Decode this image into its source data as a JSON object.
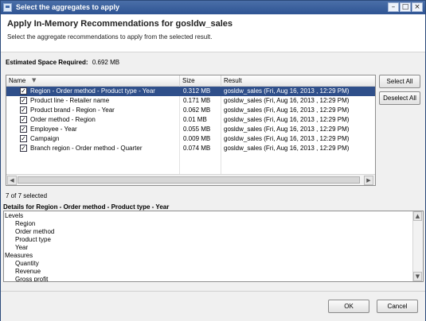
{
  "window": {
    "title": "Select the aggregates to apply"
  },
  "header": {
    "title": "Apply In-Memory Recommendations for gosldw_sales",
    "subtitle": "Select the aggregate recommendations to apply from the selected result."
  },
  "estimated_space": {
    "label": "Estimated Space Required:",
    "value": "0.692 MB"
  },
  "table": {
    "columns": [
      "Name",
      "Size",
      "Result"
    ],
    "rows": [
      {
        "name": "Region - Order method - Product type - Year",
        "size": "0.312 MB",
        "result": "gosldw_sales (Fri, Aug 16, 2013 , 12:29 PM)",
        "checked": true,
        "selected": true
      },
      {
        "name": "Product line - Retailer name",
        "size": "0.171 MB",
        "result": "gosldw_sales (Fri, Aug 16, 2013 , 12:29 PM)",
        "checked": true,
        "selected": false
      },
      {
        "name": "Product brand - Region - Year",
        "size": "0.062 MB",
        "result": "gosldw_sales (Fri, Aug 16, 2013 , 12:29 PM)",
        "checked": true,
        "selected": false
      },
      {
        "name": "Order method - Region",
        "size": "0.01 MB",
        "result": "gosldw_sales (Fri, Aug 16, 2013 , 12:29 PM)",
        "checked": true,
        "selected": false
      },
      {
        "name": "Employee - Year",
        "size": "0.055 MB",
        "result": "gosldw_sales (Fri, Aug 16, 2013 , 12:29 PM)",
        "checked": true,
        "selected": false
      },
      {
        "name": "Campaign",
        "size": "0.009 MB",
        "result": "gosldw_sales (Fri, Aug 16, 2013 , 12:29 PM)",
        "checked": true,
        "selected": false
      },
      {
        "name": "Branch region - Order method - Quarter",
        "size": "0.074 MB",
        "result": "gosldw_sales (Fri, Aug 16, 2013 , 12:29 PM)",
        "checked": true,
        "selected": false
      }
    ]
  },
  "buttons": {
    "select_all": "Select All",
    "deselect_all": "Deselect All",
    "ok": "OK",
    "cancel": "Cancel"
  },
  "selection_count": "7 of 7 selected",
  "details": {
    "label": "Details for Region - Order method - Product type - Year",
    "lines": [
      "Levels",
      "Region",
      "Order method",
      "Product type",
      "Year",
      "Measures",
      "Quantity",
      "Revenue",
      "Gross profit"
    ]
  },
  "colors": {
    "selection": "#2f4f8a",
    "titlebar": "#3a5f9e"
  }
}
